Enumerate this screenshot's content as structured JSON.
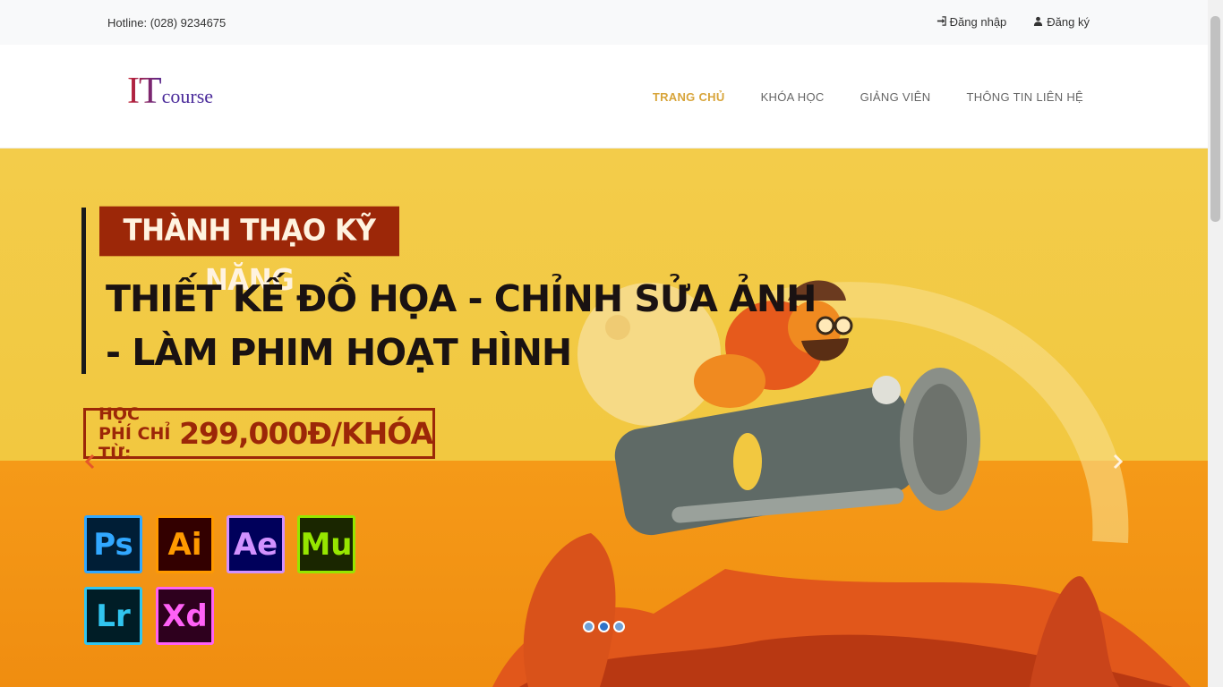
{
  "topbar": {
    "hotline": "Hotline: (028) 9234675",
    "login_label": "Đăng nhập",
    "register_label": "Đăng ký"
  },
  "brand": {
    "logo_it": "IT",
    "logo_course": "course"
  },
  "nav": {
    "items": [
      {
        "label": "TRANG CHỦ",
        "active": true
      },
      {
        "label": "KHÓA HỌC",
        "active": false
      },
      {
        "label": "GIẢNG VIÊN",
        "active": false
      },
      {
        "label": "THÔNG TIN LIÊN HỆ",
        "active": false
      }
    ]
  },
  "hero": {
    "tag": "THÀNH THẠO KỸ NĂNG",
    "headline_line1": "THIẾT KẾ ĐỒ HỌA - CHỈNH SỬA ẢNH",
    "headline_line2": "- LÀM PHIM HOẠT HÌNH",
    "price_label": "HỌC PHÍ CHỈ TỪ:",
    "price_value": "299,000Đ/KHÓA",
    "apps": [
      {
        "abbr": "Ps",
        "fg": "#31a8ff",
        "bg": "#001e36",
        "border": "#31a8ff"
      },
      {
        "abbr": "Ai",
        "fg": "#ff9a00",
        "bg": "#330000",
        "border": "#ff9a00"
      },
      {
        "abbr": "Ae",
        "fg": "#d291ff",
        "bg": "#00005b",
        "border": "#d291ff"
      },
      {
        "abbr": "Mu",
        "fg": "#96e600",
        "bg": "#1a2600",
        "border": "#96e600"
      },
      {
        "abbr": "Lr",
        "fg": "#31c5f0",
        "bg": "#001d26",
        "border": "#31c5f0"
      },
      {
        "abbr": "Xd",
        "fg": "#ff61f6",
        "bg": "#2e001e",
        "border": "#ff61f6"
      }
    ],
    "slides_count": 3,
    "active_slide": 1
  },
  "colors": {
    "accent": "#d8a53b",
    "hero_yellow": "#f3cc4a",
    "hero_orange": "#f59a18",
    "dark_red": "#9c2708"
  }
}
